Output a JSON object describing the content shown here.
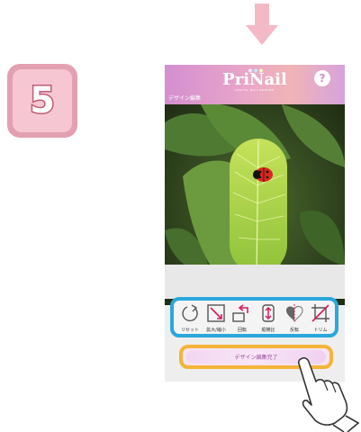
{
  "step": {
    "number": "5"
  },
  "app": {
    "logo": "PriNail",
    "logo_sub": "DIGITAL NAIL PRINTER",
    "help_label": "?",
    "screen_label": "デザイン編集"
  },
  "tools": [
    {
      "icon": "reset-icon",
      "label": "リセット"
    },
    {
      "icon": "resize-icon",
      "label": "拡大/縮小"
    },
    {
      "icon": "rotate-icon",
      "label": "回転"
    },
    {
      "icon": "aspect-ratio-icon",
      "label": "縦横比"
    },
    {
      "icon": "flip-icon",
      "label": "反転"
    },
    {
      "icon": "trim-icon",
      "label": "トリム"
    }
  ],
  "done_button": {
    "label": "デザイン編集完了"
  },
  "colors": {
    "accent_blue": "#2aa7dc",
    "accent_yellow": "#f4b437",
    "badge_pink": "#f6c7d2",
    "header_gradient_start": "#d48fd0",
    "header_gradient_end": "#f0b4b6"
  }
}
